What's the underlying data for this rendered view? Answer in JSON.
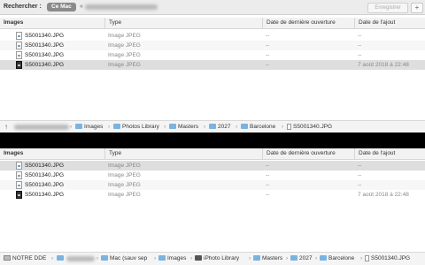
{
  "search": {
    "label": "Rechercher :",
    "scope_this_mac": "Ce Mac",
    "scope_other_prefix": "«",
    "save_label": "Enregistrer",
    "add_label": "+"
  },
  "columns": {
    "name": "Images",
    "type": "Type",
    "last_opened": "Date de dernière ouverture",
    "date_added": "Date de l'ajout"
  },
  "pane1": {
    "rows": [
      {
        "name": "S5001340.JPG",
        "type": "Image JPEG",
        "last_opened": "--",
        "date_added": "--"
      },
      {
        "name": "S5001340.JPG",
        "type": "Image JPEG",
        "last_opened": "--",
        "date_added": "--"
      },
      {
        "name": "S5001340.JPG",
        "type": "Image JPEG",
        "last_opened": "--",
        "date_added": "--"
      },
      {
        "name": "S5001340.JPG",
        "type": "Image JPEG",
        "last_opened": "--",
        "date_added": "7 août 2018 à 22:48"
      }
    ],
    "path": {
      "up_icon": "↑",
      "items": [
        "Images",
        "Photos Library",
        "Masters",
        "2027",
        "Barcelone",
        "S5001340.JPG"
      ]
    }
  },
  "pane2": {
    "rows": [
      {
        "name": "S5001340.JPG",
        "type": "Image JPEG",
        "last_opened": "--",
        "date_added": "--"
      },
      {
        "name": "S5001340.JPG",
        "type": "Image JPEG",
        "last_opened": "--",
        "date_added": "--"
      },
      {
        "name": "S5001340.JPG",
        "type": "Image JPEG",
        "last_opened": "--",
        "date_added": "--"
      },
      {
        "name": "S5001340.JPG",
        "type": "Image JPEG",
        "last_opened": "--",
        "date_added": "7 août 2018 à 22:48"
      }
    ],
    "path": {
      "items": [
        "NOTRE DDE",
        "Mac (sauv sep",
        "Images",
        "iPhoto Library",
        "Masters",
        "2027",
        "Barcelone",
        "S5001340.JPG"
      ]
    }
  },
  "chevron": "›"
}
